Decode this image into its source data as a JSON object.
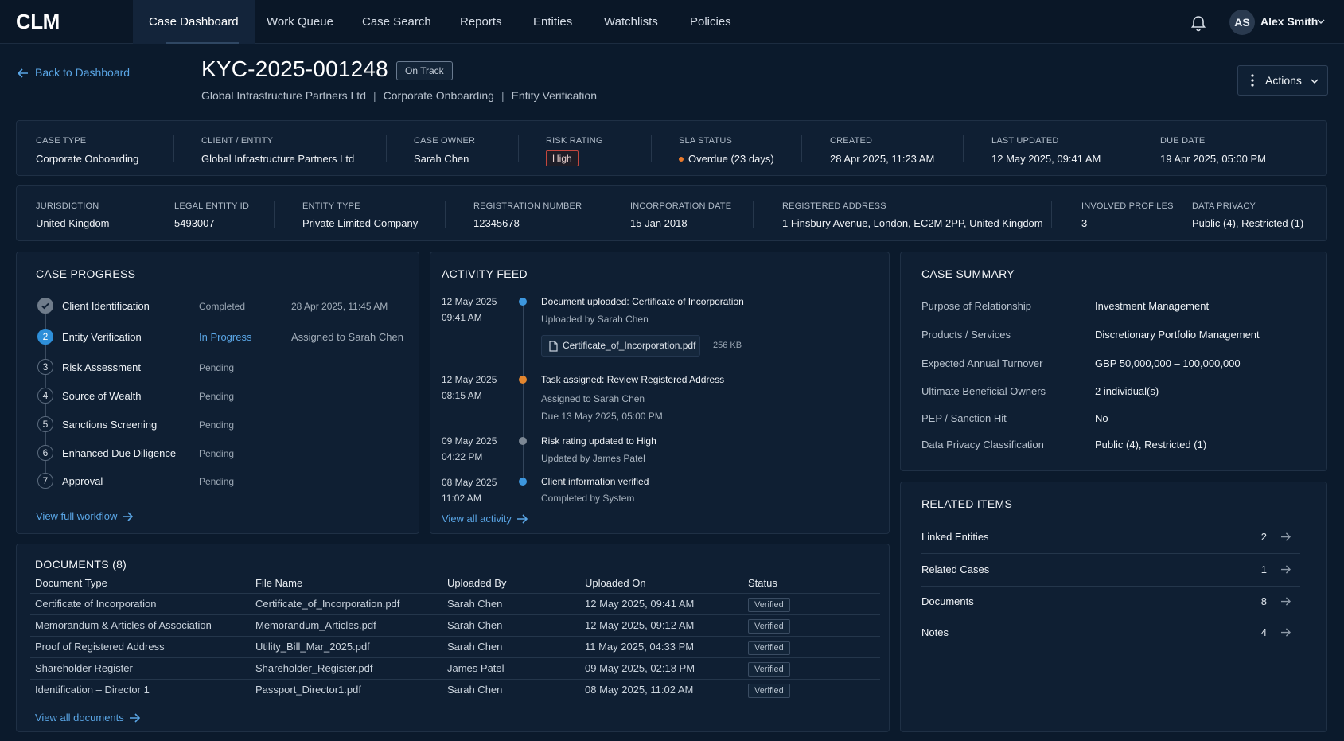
{
  "nav": {
    "logo": "CLM",
    "tabs": [
      {
        "label": "Case Dashboard",
        "active": true
      },
      {
        "label": "Work Queue"
      },
      {
        "label": "Case Search"
      },
      {
        "label": "Reports"
      },
      {
        "label": "Entities"
      },
      {
        "label": "Watchlists"
      },
      {
        "label": "Policies"
      }
    ],
    "user": {
      "initials": "AS",
      "name": "Alex Smith"
    }
  },
  "header": {
    "back_label": "Back to Dashboard",
    "case_id": "KYC-2025-001248",
    "status_badge": "On Track",
    "subtitle": [
      "Global Infrastructure Partners Ltd",
      "Corporate Onboarding",
      "Entity Verification"
    ],
    "separator": "|",
    "actions_label": "Actions"
  },
  "overview": {
    "case_type": {
      "label": "CASE TYPE",
      "value": "Corporate Onboarding"
    },
    "client": {
      "label": "CLIENT / ENTITY",
      "value": "Global Infrastructure Partners Ltd"
    },
    "owner": {
      "label": "CASE OWNER",
      "value": "Sarah Chen"
    },
    "risk": {
      "label": "RISK RATING",
      "value": "High"
    },
    "sla": {
      "label": "SLA STATUS",
      "value": "Overdue (23 days)"
    },
    "created": {
      "label": "CREATED",
      "value": "28 Apr 2025, 11:23 AM"
    },
    "updated": {
      "label": "LAST UPDATED",
      "value": "12 May 2025, 09:41 AM"
    },
    "due": {
      "label": "DUE DATE",
      "value": "19 Apr 2025, 05:00 PM"
    }
  },
  "entity": {
    "jurisdiction": {
      "label": "JURISDICTION",
      "value": "United Kingdom"
    },
    "lei": {
      "label": "LEGAL ENTITY ID",
      "value": "5493007"
    },
    "type": {
      "label": "ENTITY TYPE",
      "value": "Private Limited Company"
    },
    "reg": {
      "label": "REGISTRATION NUMBER",
      "value": "12345678"
    },
    "inc": {
      "label": "INCORPORATION DATE",
      "value": "15 Jan 2018"
    },
    "address": {
      "label": "REGISTERED ADDRESS",
      "value": "1 Finsbury Avenue, London, EC2M 2PP, United Kingdom"
    },
    "profiles": {
      "label": "INVOLVED PROFILES",
      "value": "3"
    },
    "privacy": {
      "label": "DATA PRIVACY",
      "value": "Public (4), Restricted (1)"
    }
  },
  "progress": {
    "title": "CASE PROGRESS",
    "steps": [
      {
        "num": "",
        "name": "Client Identification",
        "status": "Completed",
        "meta": "28 Apr 2025, 11:45 AM"
      },
      {
        "num": "2",
        "name": "Entity Verification",
        "status": "In Progress",
        "meta": "Assigned to Sarah Chen"
      },
      {
        "num": "3",
        "name": "Risk Assessment",
        "status": "Pending",
        "meta": ""
      },
      {
        "num": "4",
        "name": "Source of Wealth",
        "status": "Pending",
        "meta": ""
      },
      {
        "num": "5",
        "name": "Sanctions Screening",
        "status": "Pending",
        "meta": ""
      },
      {
        "num": "6",
        "name": "Enhanced Due Diligence",
        "status": "Pending",
        "meta": ""
      },
      {
        "num": "7",
        "name": "Approval",
        "status": "Pending",
        "meta": ""
      }
    ],
    "link": "View full workflow"
  },
  "activity": {
    "title": "ACTIVITY FEED",
    "items": [
      {
        "date": "12 May 2025",
        "time": "09:41 AM",
        "title": "Document uploaded: Certificate of Incorporation",
        "sub": "Uploaded by Sarah Chen",
        "sub2": "",
        "color": "#3d97de"
      },
      {
        "date": "12 May 2025",
        "time": "08:15 AM",
        "title": "Task assigned: Review Registered Address",
        "sub": "Assigned to Sarah Chen",
        "sub2": "Due 13 May 2025, 05:00 PM",
        "color": "#e3862f"
      },
      {
        "date": "09 May 2025",
        "time": "04:22 PM",
        "title": "Risk rating updated to High",
        "sub": "Updated by James Patel",
        "sub2": "",
        "color": "#7c8794"
      },
      {
        "date": "08 May 2025",
        "time": "11:02 AM",
        "title": "Client information verified",
        "sub": "Completed by System",
        "sub2": "",
        "color": "#3d97de"
      }
    ],
    "file": {
      "name": "Certificate_of_Incorporation.pdf",
      "size": "256 KB"
    },
    "link": "View all activity"
  },
  "summary": {
    "title": "CASE SUMMARY",
    "rows": [
      {
        "key": "Purpose of Relationship",
        "value": "Investment Management"
      },
      {
        "key": "Products / Services",
        "value": "Discretionary Portfolio Management"
      },
      {
        "key": "Expected Annual Turnover",
        "value": "GBP 50,000,000 – 100,000,000"
      },
      {
        "key": "Ultimate Beneficial Owners",
        "value": "2 individual(s)"
      },
      {
        "key": "PEP / Sanction Hit",
        "value": "No"
      },
      {
        "key": "Data Privacy Classification",
        "value": "Public (4), Restricted (1)"
      }
    ]
  },
  "related": {
    "title": "RELATED ITEMS",
    "items": [
      {
        "name": "Linked Entities",
        "count": "2"
      },
      {
        "name": "Related Cases",
        "count": "1"
      },
      {
        "name": "Documents",
        "count": "8"
      },
      {
        "name": "Notes",
        "count": "4"
      }
    ]
  },
  "documents": {
    "title": "DOCUMENTS (8)",
    "columns": [
      "Document Type",
      "File Name",
      "Uploaded By",
      "Uploaded On",
      "Status"
    ],
    "rows": [
      [
        "Certificate of Incorporation",
        "Certificate_of_Incorporation.pdf",
        "Sarah Chen",
        "12 May 2025, 09:41 AM",
        "Verified"
      ],
      [
        "Memorandum & Articles of Association",
        "Memorandum_Articles.pdf",
        "Sarah Chen",
        "12 May 2025, 09:12 AM",
        "Verified"
      ],
      [
        "Proof of Registered Address",
        "Utility_Bill_Mar_2025.pdf",
        "Sarah Chen",
        "11 May 2025, 04:33 PM",
        "Verified"
      ],
      [
        "Shareholder Register",
        "Shareholder_Register.pdf",
        "James Patel",
        "09 May 2025, 02:18 PM",
        "Verified"
      ],
      [
        "Identification – Director 1",
        "Passport_Director1.pdf",
        "Sarah Chen",
        "08 May 2025, 11:02 AM",
        "Verified"
      ]
    ],
    "link": "View all documents"
  }
}
